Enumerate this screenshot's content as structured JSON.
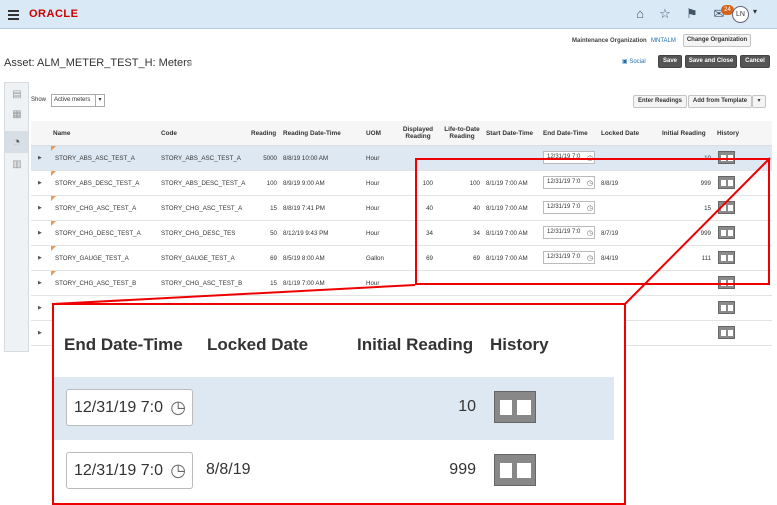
{
  "header": {
    "logo": "ORACLE",
    "badge": "24",
    "user_initials": "LN"
  },
  "org": {
    "label": "Maintenance Organization",
    "value": "MNTALM",
    "change_button": "Change Organization"
  },
  "page": {
    "title": "Asset: ALM_METER_TEST_H: Meters"
  },
  "actions": {
    "social": "Social",
    "save": "Save",
    "save_close": "Save and Close",
    "cancel": "Cancel"
  },
  "filter": {
    "label": "Show",
    "value": "Active meters"
  },
  "toolbar": {
    "enter_readings": "Enter Readings",
    "add_template": "Add from Template"
  },
  "columns": {
    "name": "Name",
    "code": "Code",
    "reading": "Reading",
    "reading_dt": "Reading Date-Time",
    "uom": "UOM",
    "displayed1": "Displayed",
    "displayed2": "Reading",
    "ltd1": "Life-to-Date",
    "ltd2": "Reading",
    "start": "Start Date-Time",
    "end": "End Date-Time",
    "locked": "Locked Date",
    "initial": "Initial Reading",
    "history": "History"
  },
  "rows": [
    {
      "name": "STORY_ABS_ASC_TEST_A",
      "code": "STORY_ABS_ASC_TEST_A",
      "reading": "5000",
      "reading_dt": "8/8/19 10:00 AM",
      "uom": "Hour",
      "displayed": "",
      "ltd": "",
      "start": "",
      "end": "12/31/19 7:0",
      "locked": "",
      "initial": "10"
    },
    {
      "name": "STORY_ABS_DESC_TEST_A",
      "code": "STORY_ABS_DESC_TEST_A",
      "reading": "100",
      "reading_dt": "8/9/19 9:00 AM",
      "uom": "Hour",
      "displayed": "100",
      "ltd": "100",
      "start": "8/1/19 7:00 AM",
      "end": "12/31/19 7:0",
      "locked": "8/8/19",
      "initial": "999"
    },
    {
      "name": "STORY_CHG_ASC_TEST_A",
      "code": "STORY_CHG_ASC_TEST_A",
      "reading": "15",
      "reading_dt": "8/8/19 7:41 PM",
      "uom": "Hour",
      "displayed": "40",
      "ltd": "40",
      "start": "8/1/19 7:00 AM",
      "end": "12/31/19 7:0",
      "locked": "",
      "initial": "15"
    },
    {
      "name": "STORY_CHG_DESC_TEST_A",
      "code": "STORY_CHG_DESC_TES",
      "reading": "50",
      "reading_dt": "8/12/19 9:43 PM",
      "uom": "Hour",
      "displayed": "34",
      "ltd": "34",
      "start": "8/1/19 7:00 AM",
      "end": "12/31/19 7:0",
      "locked": "8/7/19",
      "initial": "999"
    },
    {
      "name": "STORY_GAUGE_TEST_A",
      "code": "STORY_GAUGE_TEST_A",
      "reading": "69",
      "reading_dt": "8/5/19 8:00 AM",
      "uom": "Gallon",
      "displayed": "69",
      "ltd": "69",
      "start": "8/1/19 7:00 AM",
      "end": "12/31/19 7:0",
      "locked": "8/4/19",
      "initial": "111"
    },
    {
      "name": "STORY_CHG_ASC_TEST_B",
      "code": "STORY_CHG_ASC_TEST_B",
      "reading": "15",
      "reading_dt": "8/1/19 7:00 AM",
      "uom": "Hour",
      "displayed": "",
      "ltd": "",
      "start": "",
      "end": "",
      "locked": "",
      "initial": ""
    }
  ],
  "zoom": {
    "h_end": "End Date-Time",
    "h_locked": "Locked Date",
    "h_initial": "Initial Reading",
    "h_history": "History",
    "r1_end": "12/31/19 7:0",
    "r1_initial": "10",
    "r2_end": "12/31/19 7:0",
    "r2_locked": "8/8/19",
    "r2_initial": "999"
  }
}
